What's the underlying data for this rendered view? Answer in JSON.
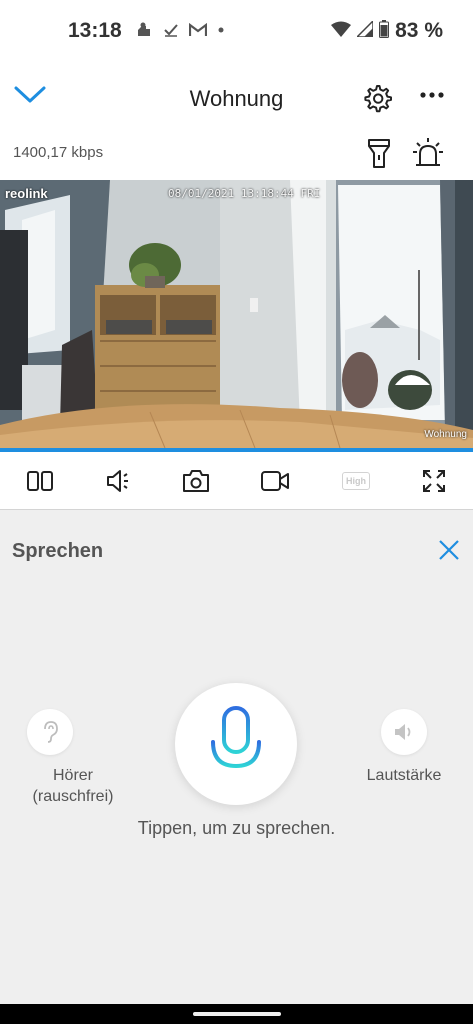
{
  "status_bar": {
    "time": "13:18",
    "battery_percent": "83 %",
    "icons": [
      "app-notification-icon",
      "check-icon",
      "gmail-icon",
      "dot-icon",
      "wifi-icon",
      "signal-icon",
      "battery-icon"
    ]
  },
  "header": {
    "title": "Wohnung",
    "bitrate": "1400,17 kbps",
    "icons": [
      "chevron-down-icon",
      "gear-icon",
      "more-icon",
      "flashlight-icon",
      "siren-icon"
    ]
  },
  "video": {
    "osd_logo": "reolink",
    "osd_datetime": "08/01/2021 13:18:44 FRI",
    "osd_camera_name": "Wohnung"
  },
  "toolbar": {
    "icons": [
      "split-view-icon",
      "speaker-icon",
      "camera-icon",
      "video-record-icon",
      "hd-quality-icon",
      "fullscreen-icon"
    ],
    "quality_label": "High"
  },
  "talk_panel": {
    "title": "Sprechen",
    "ear_label": "Hörer (rauschfrei)",
    "volume_label": "Lautstärke",
    "hint": "Tippen, um zu sprechen."
  },
  "colors": {
    "accent": "#1e8ee0",
    "mic_gradient_top": "#2f6fe0",
    "mic_gradient_bottom": "#2ed3d6",
    "panel_bg": "#efefef"
  }
}
